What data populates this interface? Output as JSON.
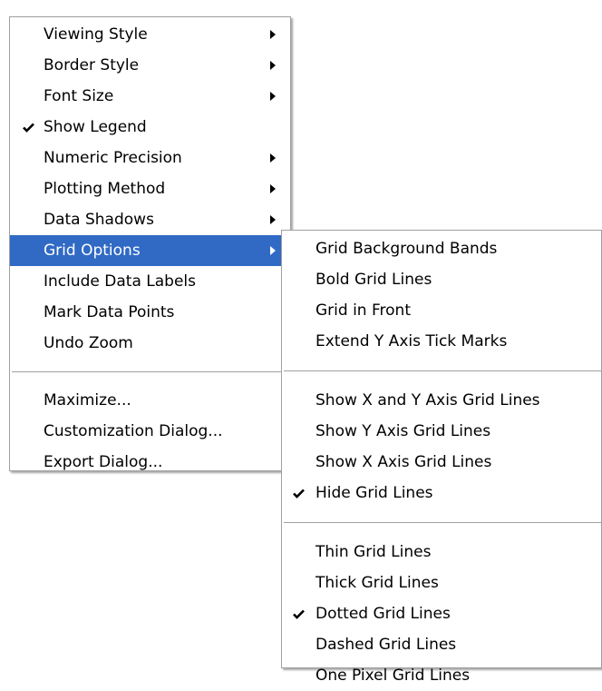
{
  "main_menu": {
    "items": [
      {
        "label": "Viewing Style",
        "submenu": true,
        "checked": false
      },
      {
        "label": "Border Style",
        "submenu": true,
        "checked": false
      },
      {
        "label": "Font Size",
        "submenu": true,
        "checked": false
      },
      {
        "label": "Show Legend",
        "submenu": false,
        "checked": true
      },
      {
        "label": "Numeric Precision",
        "submenu": true,
        "checked": false
      },
      {
        "label": "Plotting Method",
        "submenu": true,
        "checked": false
      },
      {
        "label": "Data Shadows",
        "submenu": true,
        "checked": false
      },
      {
        "label": "Grid Options",
        "submenu": true,
        "checked": false,
        "highlighted": true
      },
      {
        "label": "Include Data Labels",
        "submenu": false,
        "checked": false
      },
      {
        "label": "Mark Data Points",
        "submenu": false,
        "checked": false
      },
      {
        "label": "Undo Zoom",
        "submenu": false,
        "checked": false
      },
      {
        "label": "Maximize...",
        "submenu": false,
        "checked": false
      },
      {
        "label": "Customization Dialog...",
        "submenu": false,
        "checked": false
      },
      {
        "label": "Export Dialog...",
        "submenu": false,
        "checked": false
      }
    ]
  },
  "grid_options_submenu": {
    "items": [
      {
        "label": "Grid Background Bands",
        "checked": false
      },
      {
        "label": "Bold Grid Lines",
        "checked": false
      },
      {
        "label": "Grid in Front",
        "checked": false
      },
      {
        "label": "Extend Y Axis Tick Marks",
        "checked": false
      },
      {
        "label": "Show X and Y Axis Grid Lines",
        "checked": false
      },
      {
        "label": "Show Y Axis Grid Lines",
        "checked": false
      },
      {
        "label": "Show X Axis Grid Lines",
        "checked": false
      },
      {
        "label": "Hide Grid Lines",
        "checked": true
      },
      {
        "label": "Thin Grid Lines",
        "checked": false
      },
      {
        "label": "Thick Grid Lines",
        "checked": false
      },
      {
        "label": "Dotted Grid Lines",
        "checked": true
      },
      {
        "label": "Dashed Grid Lines",
        "checked": false
      },
      {
        "label": "One Pixel Grid Lines",
        "checked": false
      }
    ]
  },
  "colors": {
    "highlight_bg": "#316ac5",
    "highlight_text": "#ffffff",
    "separator": "#a0a0a0"
  },
  "icons": {
    "check": "checkmark-icon",
    "submenu_arrow": "submenu-arrow-icon"
  }
}
